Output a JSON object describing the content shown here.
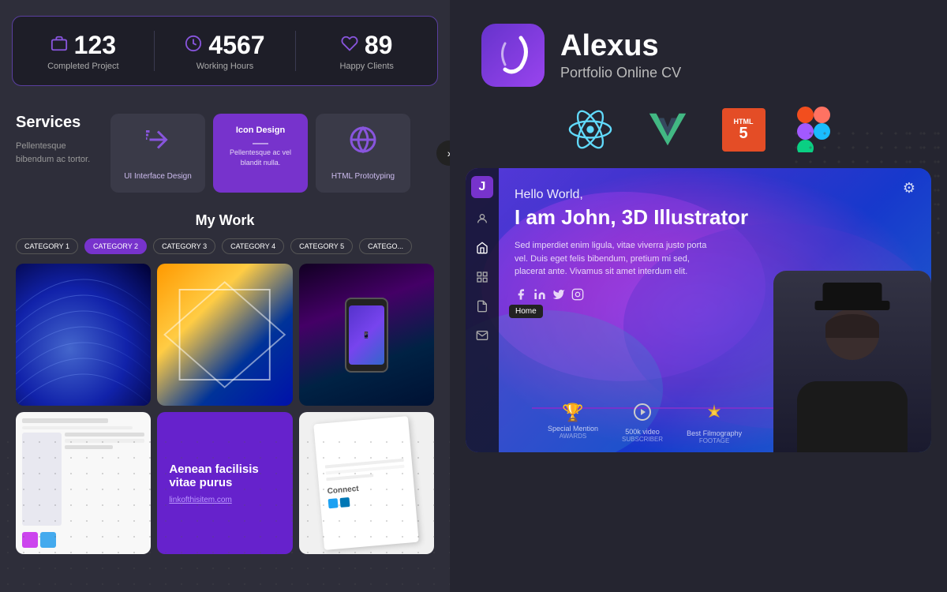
{
  "stats": {
    "items": [
      {
        "icon": "📁",
        "number": "123",
        "label": "Completed Project"
      },
      {
        "icon": "⏱",
        "number": "4567",
        "label": "Working Hours"
      },
      {
        "icon": "♡",
        "number": "89",
        "label": "Happy Clients"
      }
    ]
  },
  "services": {
    "title": "Services",
    "description": "Pellentesque bibendum ac tortor.",
    "cards": [
      {
        "title": "UI Interface Design",
        "active": false,
        "desc": ""
      },
      {
        "title": "Icon Design",
        "active": true,
        "desc": "Pellentesque ac vel blandit nulla."
      },
      {
        "title": "HTML Prototyping",
        "active": false,
        "desc": ""
      }
    ]
  },
  "mywork": {
    "title": "My Work",
    "categories": [
      "CATEGORY 1",
      "CATEGORY 2",
      "CATEGORY 3",
      "CATEGORY 4",
      "CATEGORY 5",
      "CATEGO..."
    ],
    "active_category": 1,
    "portfolio_text": "Aenean facilisis vitae purus",
    "portfolio_link": "linkofthisitem.com"
  },
  "branding": {
    "logo_letter": ")",
    "name": "Alexus",
    "subtitle": "Portfolio Online CV"
  },
  "tech": {
    "items": [
      "React",
      "Vue",
      "HTML5",
      "Figma"
    ]
  },
  "cv": {
    "greeting": "Hello World,",
    "name": "I am John, 3D Illustrator",
    "description": "Sed imperdiet enim ligula, vitae viverra justo porta vel. Duis eget felis bibendum, pretium mi sed, placerat ante. Vivamus sit amet interdum elit.",
    "sidebar_letter": "J",
    "home_tooltip": "Home",
    "gear_icon": "⚙",
    "awards": [
      {
        "icon": "🏆",
        "label": "Special Mention",
        "title": "AWARDS"
      },
      {
        "icon": "▶",
        "label": "500k video",
        "title": "SUBSCRIBER"
      },
      {
        "icon": "✦",
        "label": "Best Filmography",
        "title": "FOOTAGE"
      }
    ]
  },
  "colors": {
    "accent": "#7733cc",
    "bg_dark": "#1e1e28",
    "bg_panel": "#2e2e3a",
    "text_primary": "#ffffff",
    "text_secondary": "#aaaaaa"
  }
}
